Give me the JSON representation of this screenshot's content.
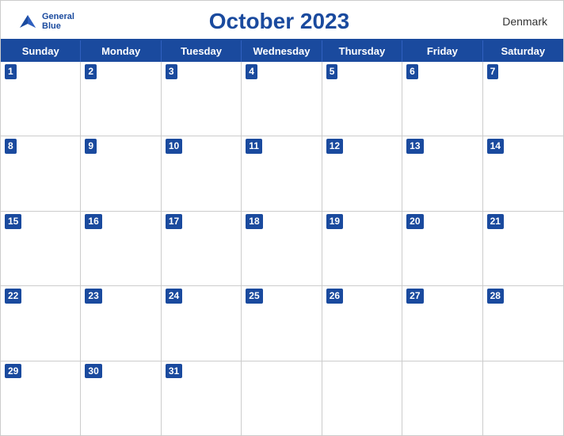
{
  "header": {
    "logo_general": "General",
    "logo_blue": "Blue",
    "month_title": "October 2023",
    "country": "Denmark"
  },
  "days_of_week": [
    "Sunday",
    "Monday",
    "Tuesday",
    "Wednesday",
    "Thursday",
    "Friday",
    "Saturday"
  ],
  "weeks": [
    [
      {
        "date": "1",
        "empty": false
      },
      {
        "date": "2",
        "empty": false
      },
      {
        "date": "3",
        "empty": false
      },
      {
        "date": "4",
        "empty": false
      },
      {
        "date": "5",
        "empty": false
      },
      {
        "date": "6",
        "empty": false
      },
      {
        "date": "7",
        "empty": false
      }
    ],
    [
      {
        "date": "8",
        "empty": false
      },
      {
        "date": "9",
        "empty": false
      },
      {
        "date": "10",
        "empty": false
      },
      {
        "date": "11",
        "empty": false
      },
      {
        "date": "12",
        "empty": false
      },
      {
        "date": "13",
        "empty": false
      },
      {
        "date": "14",
        "empty": false
      }
    ],
    [
      {
        "date": "15",
        "empty": false
      },
      {
        "date": "16",
        "empty": false
      },
      {
        "date": "17",
        "empty": false
      },
      {
        "date": "18",
        "empty": false
      },
      {
        "date": "19",
        "empty": false
      },
      {
        "date": "20",
        "empty": false
      },
      {
        "date": "21",
        "empty": false
      }
    ],
    [
      {
        "date": "22",
        "empty": false
      },
      {
        "date": "23",
        "empty": false
      },
      {
        "date": "24",
        "empty": false
      },
      {
        "date": "25",
        "empty": false
      },
      {
        "date": "26",
        "empty": false
      },
      {
        "date": "27",
        "empty": false
      },
      {
        "date": "28",
        "empty": false
      }
    ],
    [
      {
        "date": "29",
        "empty": false
      },
      {
        "date": "30",
        "empty": false
      },
      {
        "date": "31",
        "empty": false
      },
      {
        "date": "",
        "empty": true
      },
      {
        "date": "",
        "empty": true
      },
      {
        "date": "",
        "empty": true
      },
      {
        "date": "",
        "empty": true
      }
    ]
  ],
  "accent_color": "#1a4a9e"
}
